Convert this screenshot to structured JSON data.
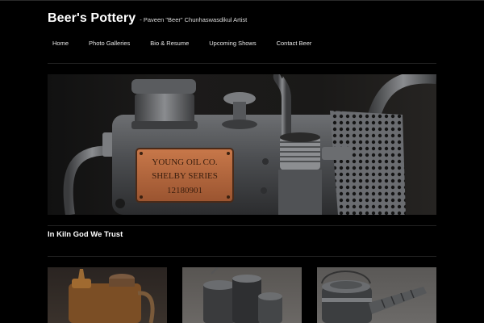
{
  "site": {
    "title": "Beer's Pottery",
    "description": "- Paveen \"Beer\" Chunhaswasdikul Artist"
  },
  "nav": {
    "items": [
      {
        "label": "Home"
      },
      {
        "label": "Photo Galleries"
      },
      {
        "label": "Bio & Resume"
      },
      {
        "label": "Upcoming Shows"
      },
      {
        "label": "Contact Beer"
      }
    ]
  },
  "banner": {
    "plate_lines": [
      "YOUNG OIL CO.",
      "SHELBY SERIES",
      "12180901"
    ]
  },
  "main": {
    "section_title": "In Kiln God We Trust"
  },
  "colors": {
    "background": "#000000",
    "plate": "#b86a3c"
  }
}
